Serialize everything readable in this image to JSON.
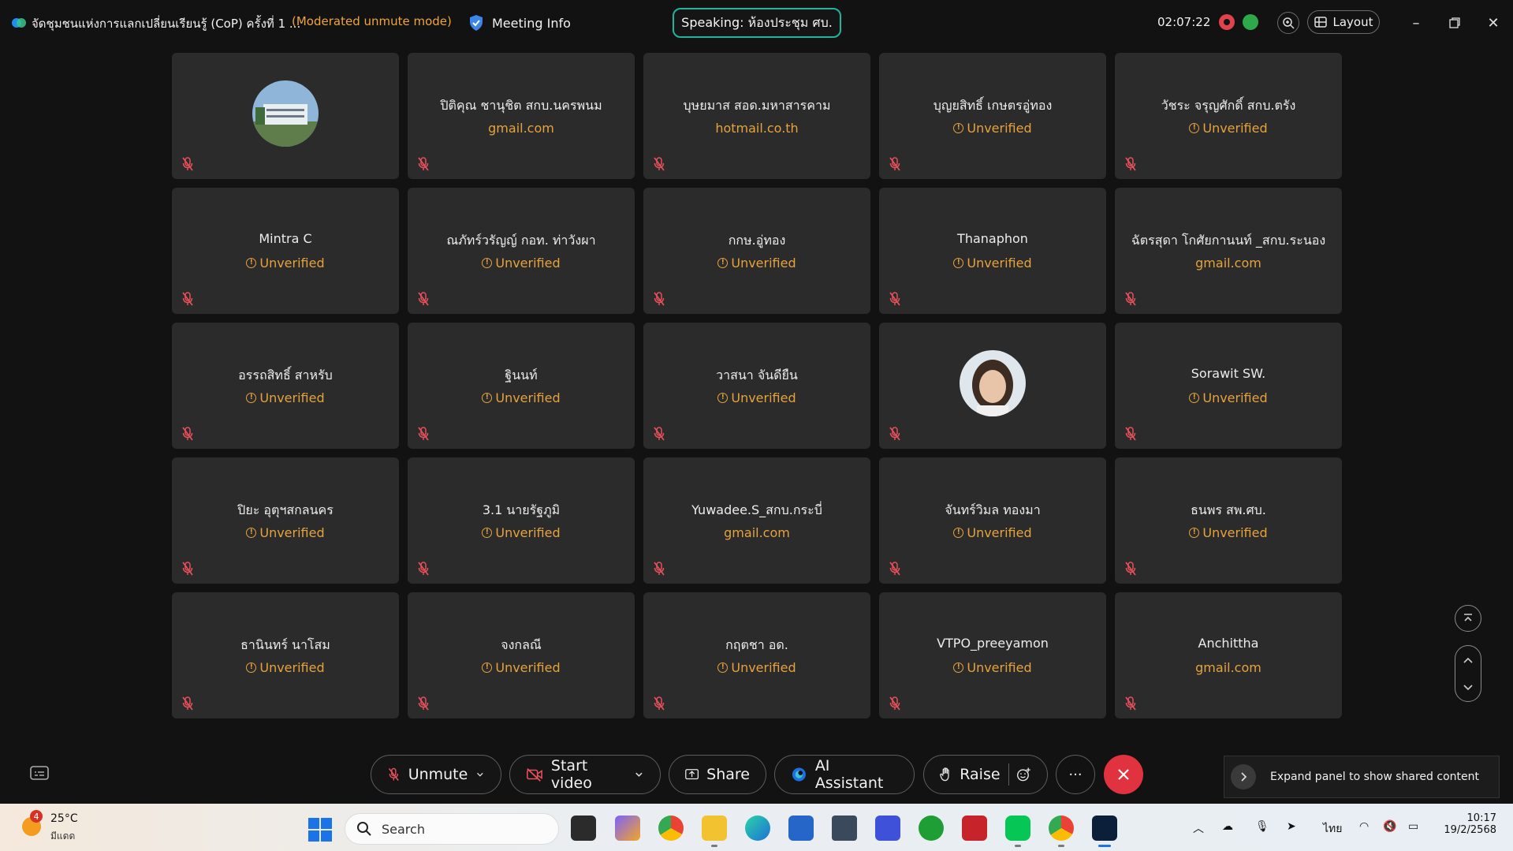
{
  "titlebar": {
    "title": "จัดชุมชนแห่งการแลกเปลี่ยนเรียนรู้ (CoP) ครั้งที่ 1 ...",
    "mode": "(Moderated unmute mode)",
    "meeting_info": "Meeting Info",
    "speaking": "Speaking: ห้องประชุม ศบ.",
    "timer": "02:07:22",
    "layout": "Layout"
  },
  "participants": [
    {
      "name": "",
      "sub": "",
      "avatar": "building"
    },
    {
      "name": "ปิติคุณ ชานุชิต สกบ.นครพนม",
      "sub": "gmail.com",
      "unverified": false
    },
    {
      "name": "บุษยมาส สอด.มหาสารคาม",
      "sub": "hotmail.co.th",
      "unverified": false
    },
    {
      "name": "บุญยสิทธิ์ เกษตรอู่ทอง",
      "sub": "Unverified",
      "unverified": true
    },
    {
      "name": "วัชระ จรุญศักดิ์ สกบ.ตรัง",
      "sub": "Unverified",
      "unverified": true
    },
    {
      "name": "Mintra C",
      "sub": "Unverified",
      "unverified": true
    },
    {
      "name": "ณภัทร์วรัญญ์ กอท. ท่าวังผา",
      "sub": "Unverified",
      "unverified": true
    },
    {
      "name": "กกษ.อู่ทอง",
      "sub": "Unverified",
      "unverified": true
    },
    {
      "name": "Thanaphon",
      "sub": "Unverified",
      "unverified": true
    },
    {
      "name": "ฉัตรสุดา โกศัยกานนท์ _สกบ.ระนอง",
      "sub": "gmail.com",
      "unverified": false
    },
    {
      "name": "อรรถสิทธิ์ สาหรับ",
      "sub": "Unverified",
      "unverified": true
    },
    {
      "name": "ฐินนท์",
      "sub": "Unverified",
      "unverified": true
    },
    {
      "name": "วาสนา จันดียืน",
      "sub": "Unverified",
      "unverified": true
    },
    {
      "name": "",
      "sub": "",
      "avatar": "person"
    },
    {
      "name": "Sorawit SW.",
      "sub": "Unverified",
      "unverified": true
    },
    {
      "name": "ปิยะ อุตุฯสกลนคร",
      "sub": "Unverified",
      "unverified": true
    },
    {
      "name": "3.1 นายรัฐภูมิ",
      "sub": "Unverified",
      "unverified": true
    },
    {
      "name": "Yuwadee.S_สกบ.กระบี่",
      "sub": "gmail.com",
      "unverified": false
    },
    {
      "name": "จันทร์วิมล  ทองมา",
      "sub": "Unverified",
      "unverified": true
    },
    {
      "name": "ธนพร สพ.ศบ.",
      "sub": "Unverified",
      "unverified": true
    },
    {
      "name": "ธานินทร์  นาโสม",
      "sub": "Unverified",
      "unverified": true
    },
    {
      "name": "จงกลณี",
      "sub": "Unverified",
      "unverified": true
    },
    {
      "name": "กฤตชา อด.",
      "sub": "Unverified",
      "unverified": true
    },
    {
      "name": "VTPO_preeyamon",
      "sub": "Unverified",
      "unverified": true
    },
    {
      "name": "Anchittha",
      "sub": "gmail.com",
      "unverified": false
    }
  ],
  "controls": {
    "unmute": "Unmute",
    "start_video": "Start video",
    "share": "Share",
    "ai_assistant": "AI Assistant",
    "raise": "Raise",
    "more": "···",
    "expand_panel": "Expand panel to show shared content"
  },
  "taskbar": {
    "weather_badge": "4",
    "temperature": "25°C",
    "weather_text": "มีแดด",
    "search": "Search",
    "lang": "ไทย",
    "time": "10:17",
    "date": "19/2/2568"
  },
  "colors": {
    "accent_speaking": "#1fb59c",
    "unverified": "#e6a23c",
    "leave": "#e0333f",
    "mute_icon": "#e8505b"
  }
}
